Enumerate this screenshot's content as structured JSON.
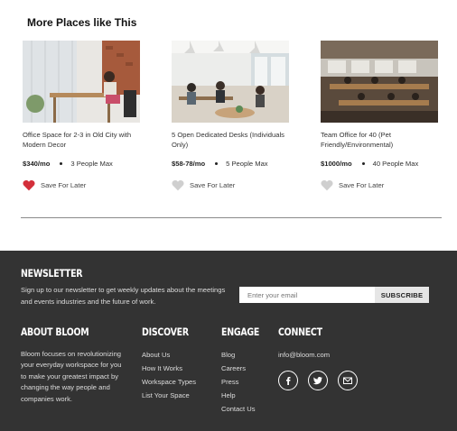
{
  "section": {
    "title": "More Places like This"
  },
  "cards": [
    {
      "title": "Office Space for 2-3 in Old City with Modern Decor",
      "price": "$340/mo",
      "capacity": "3 People Max",
      "save_label": "Save For Later",
      "saved": true
    },
    {
      "title": "5 Open Dedicated Desks (Individuals Only)",
      "price": "$58-78/mo",
      "capacity": "5 People Max",
      "save_label": "Save For Later",
      "saved": false
    },
    {
      "title": "Team Office for 40 (Pet Friendly/Environmental)",
      "price": "$1000/mo",
      "capacity": "40 People Max",
      "save_label": "Save For Later",
      "saved": false
    }
  ],
  "newsletter": {
    "title": "NEWSLETTER",
    "text": "Sign up to our newsletter to get weekly updates about the meetings and events industries and the future of work.",
    "placeholder": "Enter your email",
    "button": "SUBSCRIBE"
  },
  "about": {
    "title": "ABOUT BLOOM",
    "text": "Bloom focuses on revolutionizing your everyday workspace for you to make your greatest impact by changing the way people and companies work."
  },
  "discover": {
    "title": "DISCOVER",
    "links": [
      "About Us",
      "How It Works",
      "Workspace Types",
      "List Your Space"
    ]
  },
  "engage": {
    "title": "ENGAGE",
    "links": [
      "Blog",
      "Careers",
      "Press",
      "Help",
      "Contact Us"
    ]
  },
  "connect": {
    "title": "CONNECT",
    "email": "info@bloom.com",
    "socials": [
      "facebook-icon",
      "twitter-icon",
      "mail-icon"
    ]
  },
  "colors": {
    "heart_saved": "#d32f3a",
    "heart_unsaved": "#cfcfcf",
    "footer_bg": "#333333"
  }
}
